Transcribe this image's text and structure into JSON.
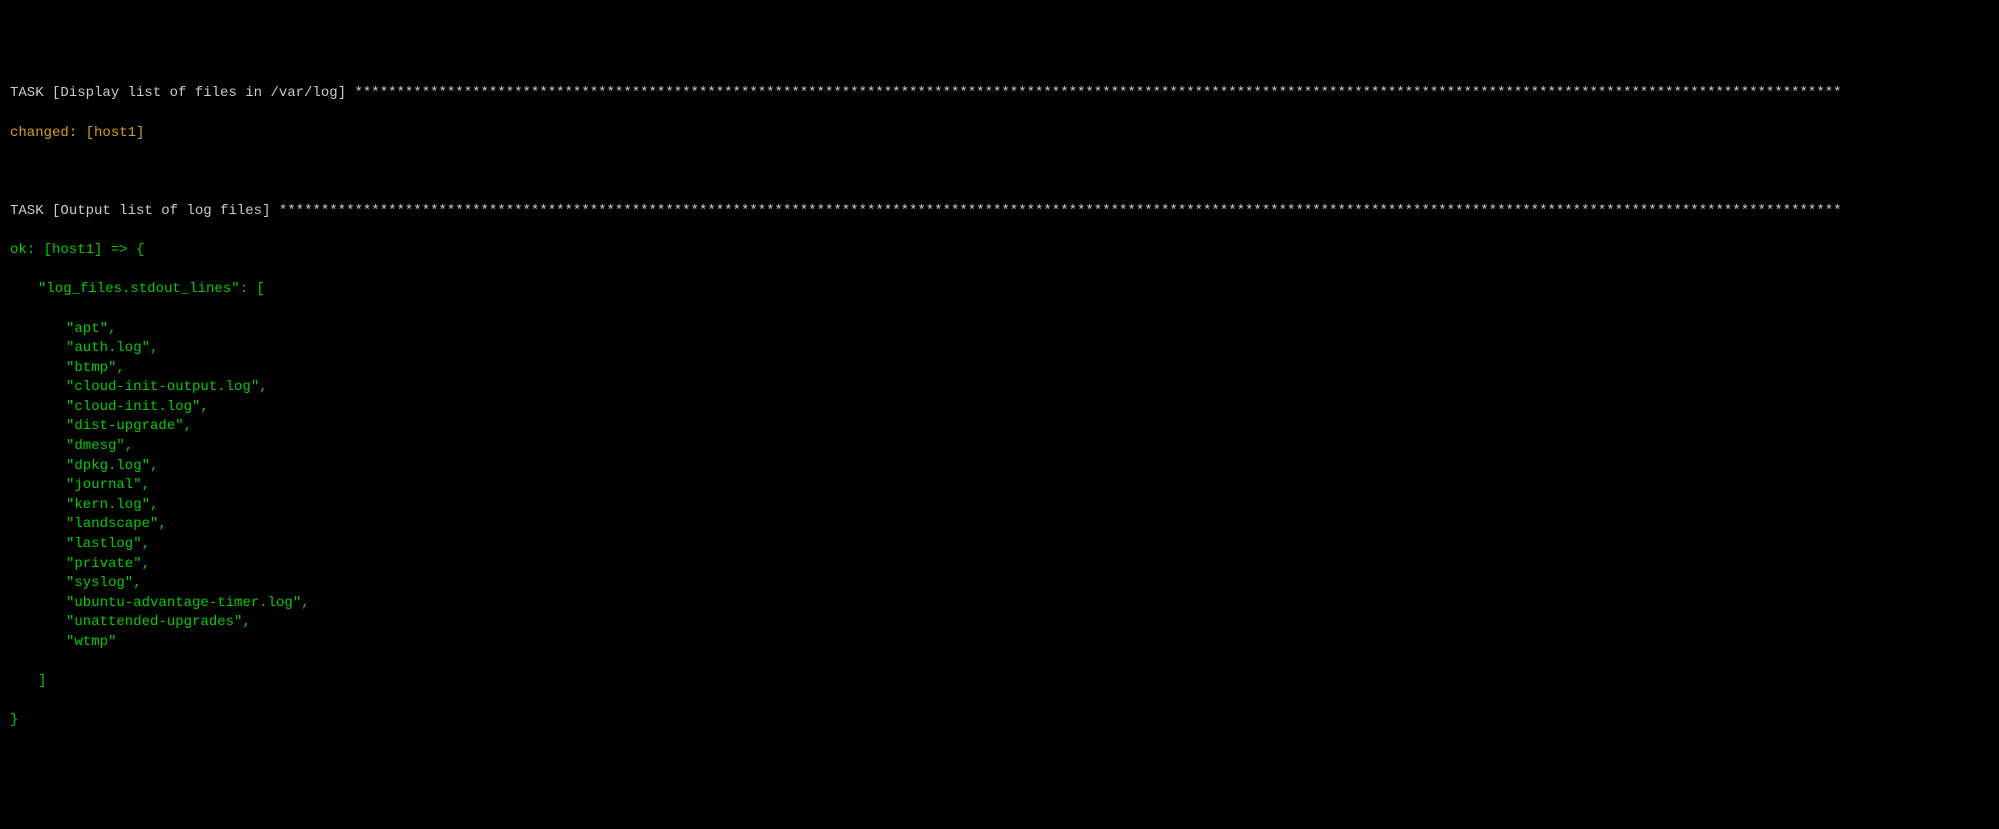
{
  "task1": {
    "header_prefix": "TASK [",
    "header_name": "Display list of files in /var/log",
    "header_suffix": "] ",
    "asterisks": "*********************************************************************************************************************************************************************************",
    "status_line": "changed: [host1]"
  },
  "task2": {
    "header_prefix": "TASK [",
    "header_name": "Output list of log files",
    "header_suffix": "] ",
    "asterisks": "******************************************************************************************************************************************************************************************",
    "ok_line": "ok: [host1] => {",
    "var_line": "\"log_files.stdout_lines\": [",
    "files": [
      "\"apt\",",
      "\"auth.log\",",
      "\"btmp\",",
      "\"cloud-init-output.log\",",
      "\"cloud-init.log\",",
      "\"dist-upgrade\",",
      "\"dmesg\",",
      "\"dpkg.log\",",
      "\"journal\",",
      "\"kern.log\",",
      "\"landscape\",",
      "\"lastlog\",",
      "\"private\",",
      "\"syslog\",",
      "\"ubuntu-advantage-timer.log\",",
      "\"unattended-upgrades\",",
      "\"wtmp\""
    ],
    "close_bracket": "]",
    "close_brace": "}"
  }
}
